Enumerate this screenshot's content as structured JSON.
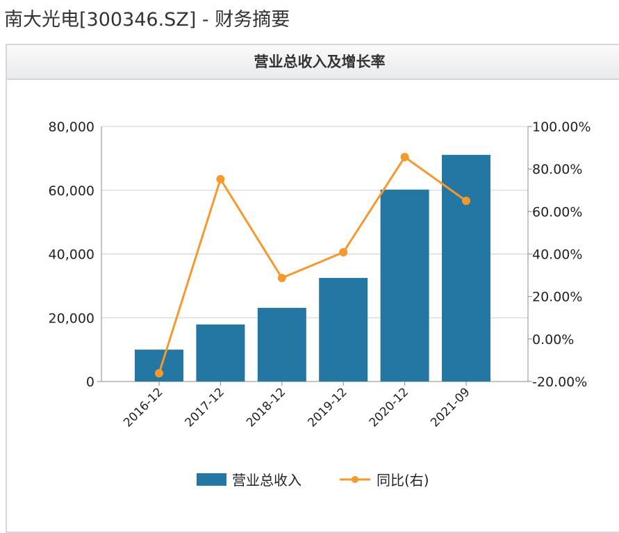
{
  "page": {
    "title": "南大光电[300346.SZ] - 财务摘要"
  },
  "chart_data": {
    "type": "bar+line",
    "title": "营业总收入及增长率",
    "categories": [
      "2016-12",
      "2017-12",
      "2018-12",
      "2019-12",
      "2020-12",
      "2021-09"
    ],
    "series": [
      {
        "name": "营业总收入",
        "type": "bar",
        "axis": "left",
        "color": "#2577a3",
        "values": [
          10000,
          17900,
          23100,
          32500,
          60200,
          71100
        ]
      },
      {
        "name": "同比(右)",
        "type": "line",
        "axis": "right",
        "color": "#f7982d",
        "values": [
          -16.1,
          75.2,
          28.7,
          40.8,
          85.6,
          65.0
        ]
      }
    ],
    "left_axis": {
      "ylim": [
        0,
        80000
      ],
      "ticks": [
        "0",
        "20,000",
        "40,000",
        "60,000",
        "80,000"
      ]
    },
    "right_axis": {
      "ylim": [
        -20,
        100
      ],
      "ticks": [
        "-20.00%",
        "0.00%",
        "20.00%",
        "40.00%",
        "60.00%",
        "80.00%",
        "100.00%"
      ]
    },
    "grid": true,
    "legend_position": "bottom"
  }
}
